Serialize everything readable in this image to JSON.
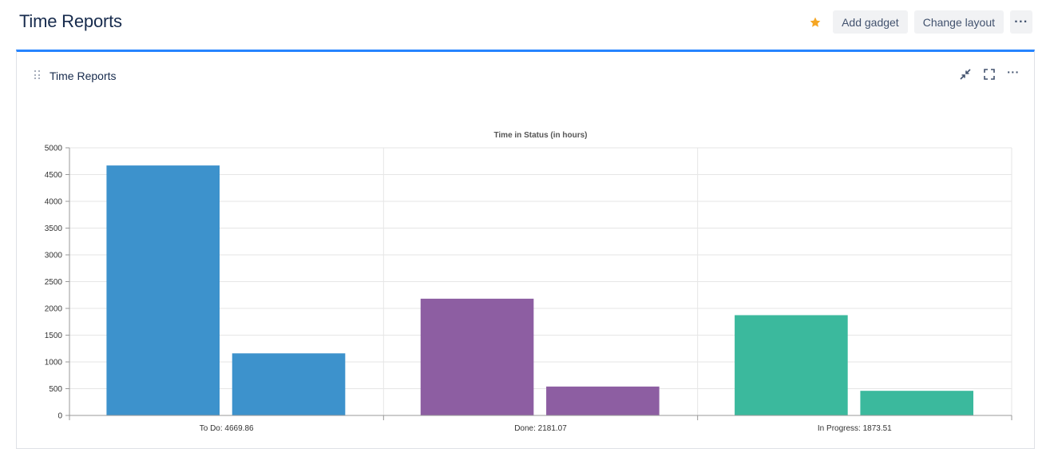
{
  "header": {
    "title": "Time Reports",
    "star_icon": "star-icon",
    "add_gadget_label": "Add gadget",
    "change_layout_label": "Change layout",
    "more_label": "···"
  },
  "gadget": {
    "title": "Time Reports",
    "minimize_icon": "minimize-icon",
    "fullscreen_icon": "fullscreen-icon",
    "more_label": "···"
  },
  "colors": {
    "accent": "#2684ff",
    "star": "#f5a623",
    "todo": "#3d92cc",
    "done": "#8d5ea2",
    "in_progress": "#3bb99d"
  },
  "chart_data": {
    "type": "bar",
    "title": "Time in Status (in hours)",
    "categories": [
      "To Do: 4669.86",
      "Done: 2181.07",
      "In Progress: 1873.51"
    ],
    "series": [
      {
        "values": [
          4669.86,
          2181.07,
          1873.51
        ]
      },
      {
        "values": [
          1160,
          540,
          460
        ]
      }
    ],
    "category_colors": [
      "#3d92cc",
      "#8d5ea2",
      "#3bb99d"
    ],
    "ylim": [
      0,
      5000
    ],
    "yticks": [
      0,
      500,
      1000,
      1500,
      2000,
      2500,
      3000,
      3500,
      4000,
      4500,
      5000
    ],
    "grid": true
  }
}
